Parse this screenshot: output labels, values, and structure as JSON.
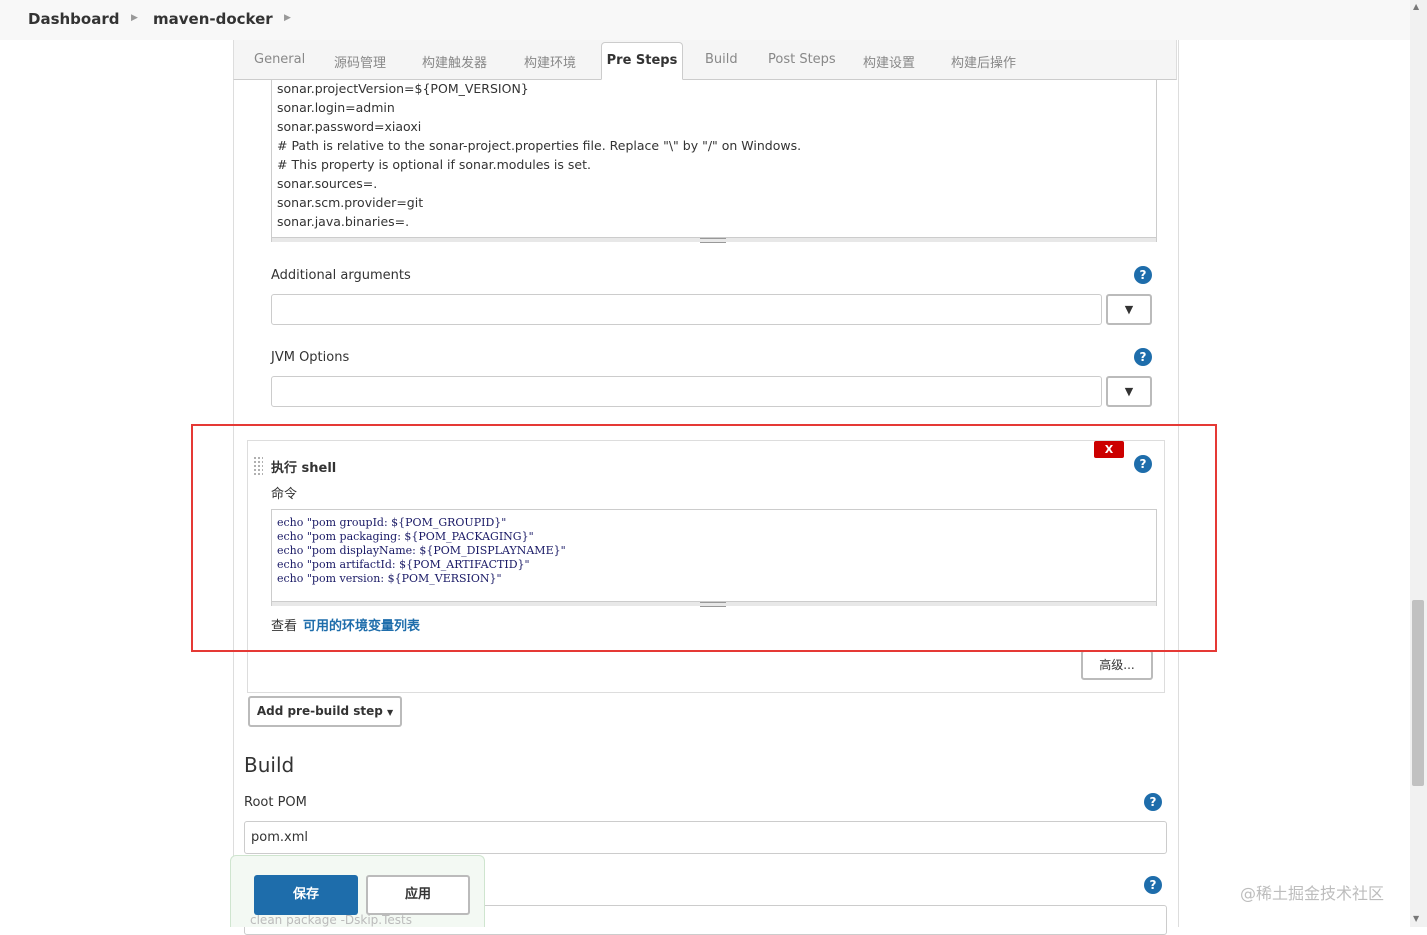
{
  "breadcrumb": {
    "items": [
      "Dashboard",
      "maven-docker"
    ]
  },
  "tabs": [
    "General",
    "源码管理",
    "构建触发器",
    "构建环境",
    "Pre Steps",
    "Build",
    "Post Steps",
    "构建设置",
    "构建后操作"
  ],
  "active_tab": "Pre Steps",
  "sonar_properties": [
    "sonar.projectVersion=${POM_VERSION}",
    "sonar.login=admin",
    "sonar.password=xiaoxi",
    "# Path is relative to the sonar-project.properties file. Replace \"\\\" by \"/\" on Windows.",
    "# This property is optional if sonar.modules is set.",
    "sonar.sources=.",
    "sonar.scm.provider=git",
    "sonar.java.binaries=."
  ],
  "additional_arguments": {
    "label": "Additional arguments",
    "value": ""
  },
  "jvm_options": {
    "label": "JVM Options",
    "value": ""
  },
  "shell_step": {
    "delete_label": "X",
    "title": "执行 shell",
    "command_label": "命令",
    "commands": [
      "echo \"pom groupId: ${POM_GROUPID}\"",
      "echo \"pom packaging: ${POM_PACKAGING}\"",
      "echo \"pom displayName: ${POM_DISPLAYNAME}\"",
      "echo \"pom artifactId: ${POM_ARTIFACTID}\"",
      "echo \"pom version: ${POM_VERSION}\""
    ],
    "env_prefix": "查看",
    "env_link": "可用的环境变量列表",
    "advanced_label": "高级..."
  },
  "add_pre_build_step": "Add pre-build step",
  "build": {
    "title": "Build",
    "root_pom_label": "Root POM",
    "root_pom_value": "pom.xml",
    "goals_value": "clean package -Dskip.Tests"
  },
  "actions": {
    "save": "保存",
    "apply": "应用"
  },
  "help_symbol": "?",
  "dropdown_symbol": "▼",
  "watermark": "@稀土掘金技术社区",
  "colors": {
    "primary": "#1e6dab",
    "delete": "#cc0000",
    "highlight_frame": "#e53935"
  }
}
